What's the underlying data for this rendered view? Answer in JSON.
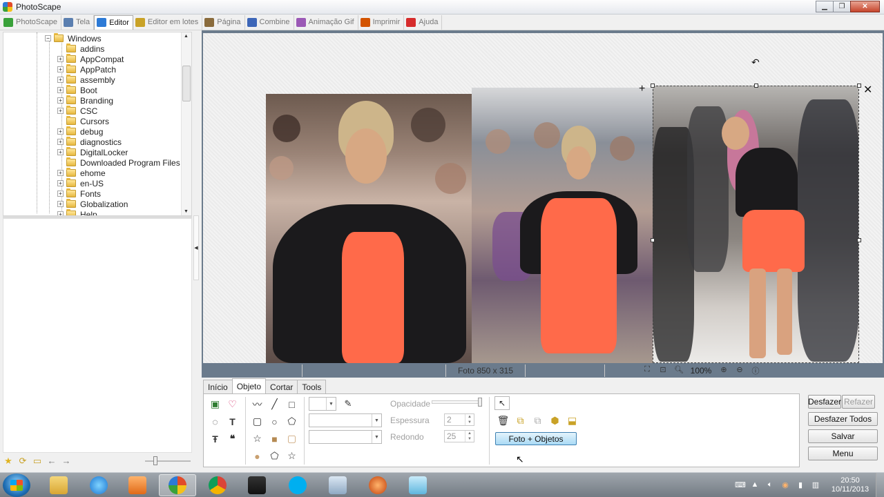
{
  "window": {
    "title": "PhotoScape"
  },
  "tabs": [
    {
      "label": "PhotoScape",
      "icon": "photoscape-icon",
      "color": "#3aa13a"
    },
    {
      "label": "Tela",
      "icon": "viewer-icon",
      "color": "#5b7fb0"
    },
    {
      "label": "Editor",
      "icon": "editor-icon",
      "color": "#2d7ad6",
      "active": true
    },
    {
      "label": "Editor em lotes",
      "icon": "batch-editor-icon",
      "color": "#c9a227"
    },
    {
      "label": "Página",
      "icon": "page-icon",
      "color": "#8a6b3c"
    },
    {
      "label": "Combine",
      "icon": "combine-icon",
      "color": "#3d66b8"
    },
    {
      "label": "Animação Gif",
      "icon": "gif-icon",
      "color": "#9b59b6"
    },
    {
      "label": "Imprimir",
      "icon": "print-icon",
      "color": "#d35400"
    },
    {
      "label": "Ajuda",
      "icon": "help-icon",
      "color": "#d62c2c"
    }
  ],
  "tree": {
    "root": "Windows",
    "items": [
      "addins",
      "AppCompat",
      "AppPatch",
      "assembly",
      "Boot",
      "Branding",
      "CSC",
      "Cursors",
      "debug",
      "diagnostics",
      "DigitalLocker",
      "Downloaded Program Files",
      "ehome",
      "en-US",
      "Fonts",
      "Globalization",
      "Help"
    ],
    "expandable": [
      false,
      true,
      true,
      true,
      true,
      true,
      true,
      false,
      true,
      true,
      true,
      false,
      true,
      true,
      true,
      true,
      true
    ]
  },
  "left_toolbar": {
    "icons": [
      "favorite-star-icon",
      "refresh-icon",
      "folder-open-icon",
      "back-icon",
      "forward-icon"
    ]
  },
  "canvas": {
    "rotate_icon": "rotate-icon",
    "add_icon": "plus-icon",
    "delete_icon": "close-icon"
  },
  "status": {
    "photo_info": "Foto 850 x 315",
    "zoom": "100%"
  },
  "bottom_tabs": [
    {
      "label": "Início"
    },
    {
      "label": "Objeto",
      "active": true
    },
    {
      "label": "Cortar"
    },
    {
      "label": "Tools"
    }
  ],
  "object_panel": {
    "opacity_label": "Opacidade",
    "thickness_label": "Espessura",
    "thickness_value": "2",
    "round_label": "Redondo",
    "round_value": "25",
    "photo_objects_button": "Foto + Objetos"
  },
  "actions": {
    "undo": "Desfazer",
    "redo": "Refazer",
    "undo_all": "Desfazer Todos",
    "save": "Salvar",
    "menu": "Menu"
  },
  "taskbar": {
    "apps": [
      "explorer",
      "internet-explorer",
      "media-player",
      "photoscape",
      "chrome",
      "movie-maker",
      "skype",
      "photo-viewer",
      "softpedia",
      "paint"
    ],
    "clock_time": "20:50",
    "clock_date": "10/11/2013"
  }
}
